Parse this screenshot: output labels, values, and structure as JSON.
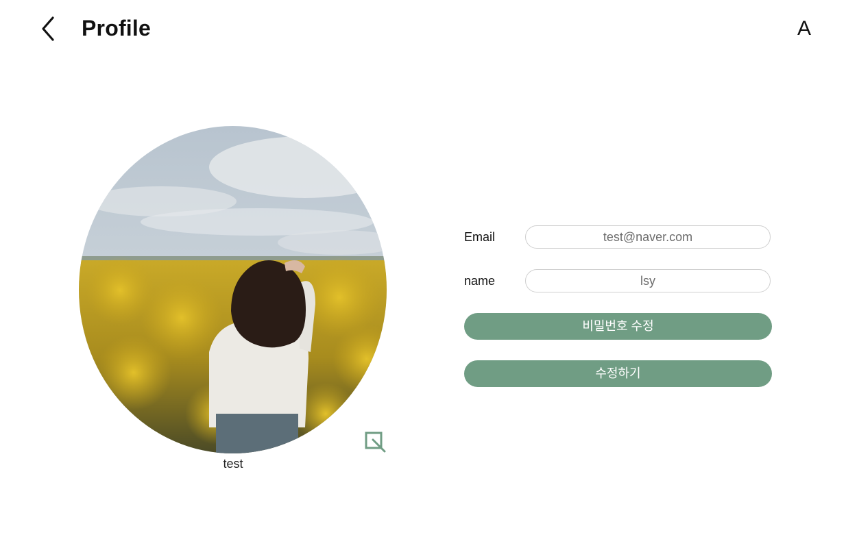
{
  "header": {
    "title": "Profile",
    "account_initial": "A",
    "back_icon": "chevron-left-icon"
  },
  "profile": {
    "username": "test",
    "photo_description_icon": "edit-photo-icon"
  },
  "form": {
    "email_label": "Email",
    "email_value": "test@naver.com",
    "name_label": "name",
    "name_value": "lsy",
    "change_password_label": "비밀번호 수정",
    "save_label": "수정하기"
  },
  "colors": {
    "accent": "#709d84",
    "input_border": "#cfcfcf",
    "input_text": "#6b6b6b"
  }
}
